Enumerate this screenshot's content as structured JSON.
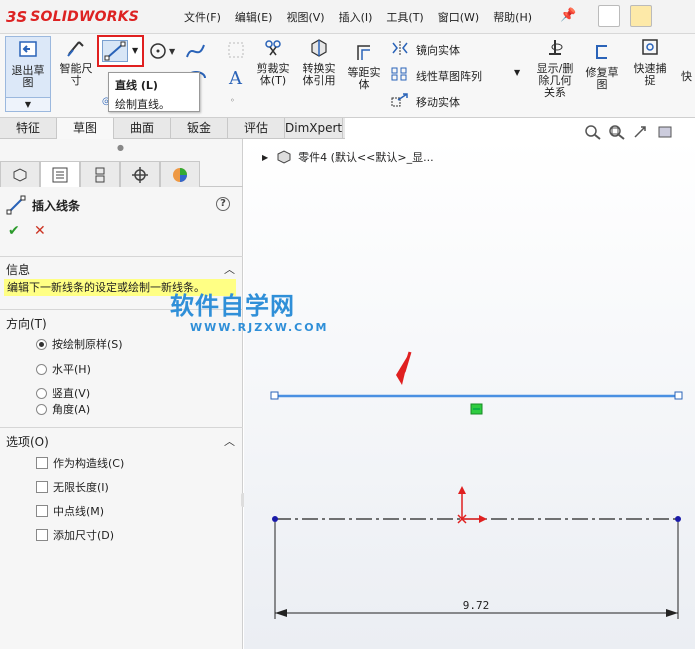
{
  "app": {
    "logo_prefix": "3S",
    "logo_text": "SOLIDWORKS"
  },
  "menu": [
    "文件(F)",
    "编辑(E)",
    "视图(V)",
    "插入(I)",
    "工具(T)",
    "窗口(W)",
    "帮助(H)"
  ],
  "ribbon": {
    "exit_sketch": "退出草\n图",
    "smart_dim": "智能尺\n寸",
    "trim": "剪裁实\n体(T)",
    "convert": "转换实\n体引用",
    "offset": "等距实\n体",
    "mirror": "镜向实体",
    "linear_pattern": "线性草图阵列",
    "move": "移动实体",
    "show_delete": "显示/删\n除几何\n关系",
    "repair": "修复草\n图",
    "quick_snap": "快速捕\n捉",
    "quick_more": "快"
  },
  "tooltip": {
    "title": "直线   (L)",
    "desc": "绘制直线。"
  },
  "tabs": [
    "特征",
    "草图",
    "曲面",
    "钣金",
    "评估",
    "DimXpert"
  ],
  "property_manager": {
    "title": "插入线条",
    "info_header": "信息",
    "info_message": "编辑下一新线条的设定或绘制一新线条。",
    "direction_header": "方向(T)",
    "direction_options": [
      {
        "label": "按绘制原样(S)",
        "checked": true
      },
      {
        "label": "水平(H)",
        "checked": false
      },
      {
        "label": "竖直(V)",
        "checked": false
      },
      {
        "label": "角度(A)",
        "checked": false
      }
    ],
    "options_header": "选项(O)",
    "options": [
      "作为构造线(C)",
      "无限长度(I)",
      "中点线(M)",
      "添加尺寸(D)"
    ]
  },
  "feature_tree": {
    "item": "零件4 (默认<<默认>_显..."
  },
  "watermark": {
    "line1": "软件自学网",
    "line2": "WWW.RJZXW.COM"
  },
  "dimension": {
    "value": "9.72"
  },
  "colors": {
    "accent": "#e02020",
    "sketch_line": "#4a90e2",
    "relation": "#2ecc40",
    "origin": "#e02020"
  }
}
